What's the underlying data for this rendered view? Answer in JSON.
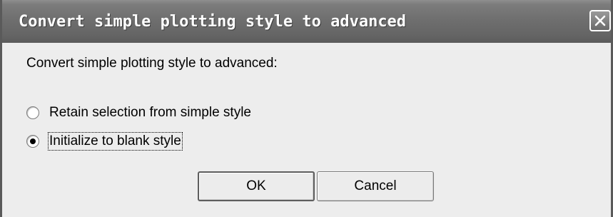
{
  "window": {
    "title": "Convert simple plotting style to advanced",
    "close_icon": "close-icon"
  },
  "dialog": {
    "prompt": "Convert simple plotting style to advanced:",
    "options": [
      {
        "label": "Retain selection from simple style",
        "selected": false
      },
      {
        "label": "Initialize to blank style",
        "selected": true
      }
    ],
    "buttons": {
      "ok": "OK",
      "cancel": "Cancel"
    }
  }
}
